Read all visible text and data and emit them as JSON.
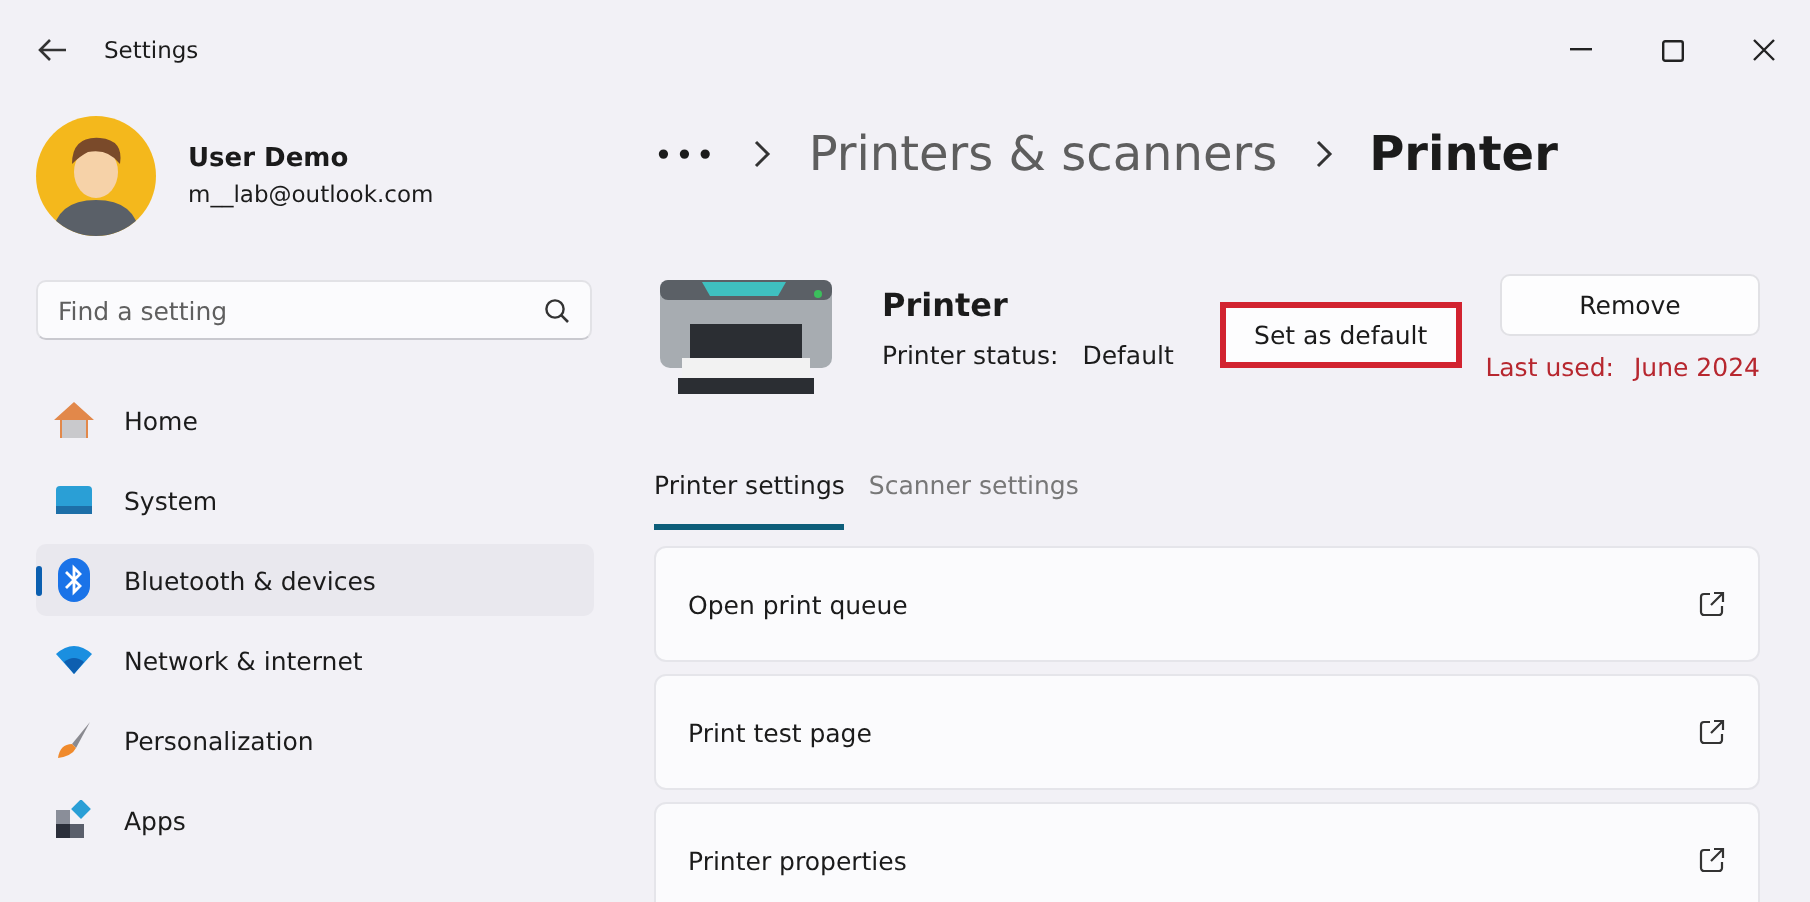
{
  "window": {
    "title": "Settings"
  },
  "user": {
    "name": "User Demo",
    "email": "m__lab@outlook.com"
  },
  "search": {
    "placeholder": "Find a setting"
  },
  "sidebar": {
    "items": [
      {
        "label": "Home",
        "kind": "home",
        "selected": false
      },
      {
        "label": "System",
        "kind": "system",
        "selected": false
      },
      {
        "label": "Bluetooth & devices",
        "kind": "bluetooth",
        "selected": true
      },
      {
        "label": "Network & internet",
        "kind": "network",
        "selected": false
      },
      {
        "label": "Personalization",
        "kind": "brush",
        "selected": false
      },
      {
        "label": "Apps",
        "kind": "apps",
        "selected": false
      }
    ]
  },
  "breadcrumb": {
    "more": "•••",
    "items": [
      "Printers & scanners",
      "Printer"
    ]
  },
  "device": {
    "name": "Printer",
    "status_label": "Printer status:",
    "status": "Default",
    "buttons": [
      {
        "label": "Set as default",
        "highlighted": true
      },
      {
        "label": "Remove",
        "highlighted": false
      }
    ],
    "last_used_label": "Last used:",
    "last_used": "June 2024"
  },
  "tabs": [
    {
      "label": "Printer settings",
      "selected": true
    },
    {
      "label": "Scanner settings",
      "selected": false
    }
  ],
  "rows": [
    {
      "label": "Open print queue"
    },
    {
      "label": "Print test page"
    },
    {
      "label": "Printer properties"
    }
  ]
}
